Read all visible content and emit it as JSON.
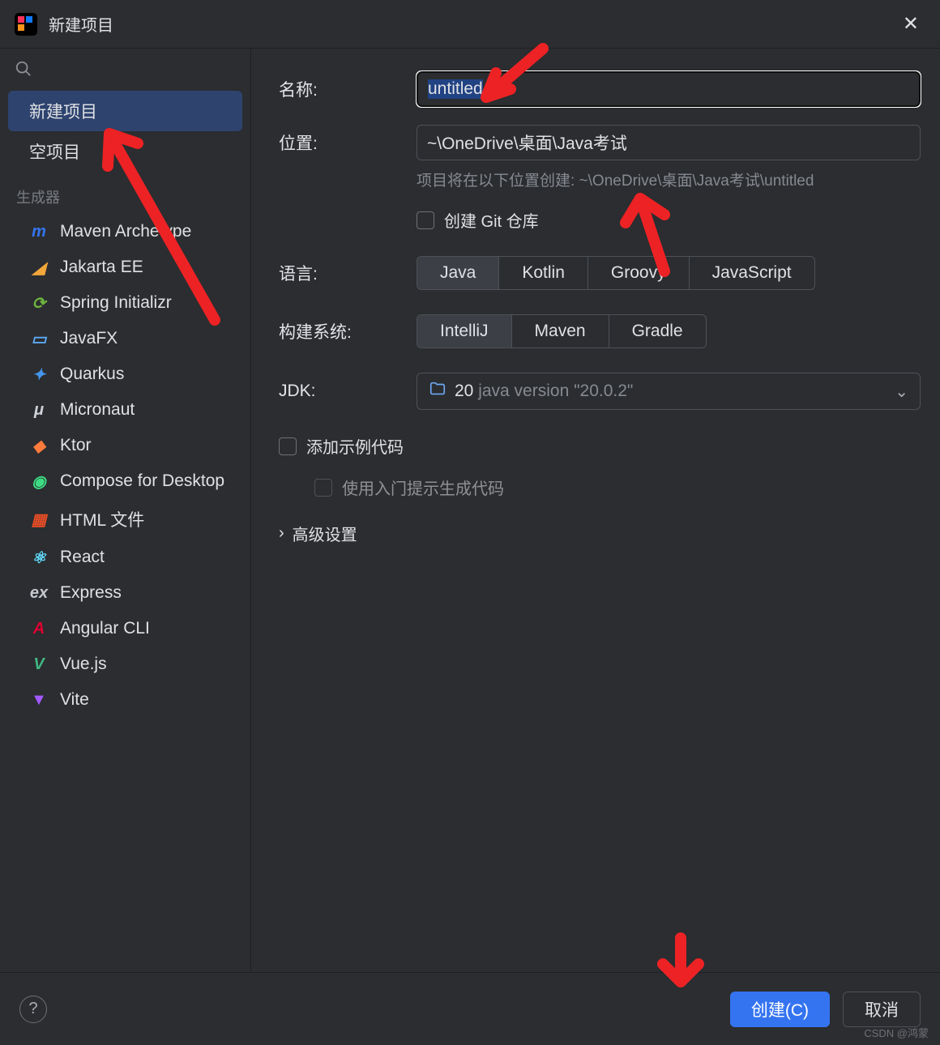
{
  "title": "新建项目",
  "sidebar": {
    "top_items": [
      {
        "label": "新建项目",
        "selected": true
      },
      {
        "label": "空项目",
        "selected": false
      }
    ],
    "section_label": "生成器",
    "generators": [
      {
        "label": "Maven Archetype",
        "color": "#3574f0",
        "glyph": "m"
      },
      {
        "label": "Jakarta EE",
        "color": "#f2a73b",
        "glyph": "◢"
      },
      {
        "label": "Spring Initializr",
        "color": "#6cb33e",
        "glyph": "⟳"
      },
      {
        "label": "JavaFX",
        "color": "#5fa8f5",
        "glyph": "▭"
      },
      {
        "label": "Quarkus",
        "color": "#4695eb",
        "glyph": "✦"
      },
      {
        "label": "Micronaut",
        "color": "#cfd2d8",
        "glyph": "μ"
      },
      {
        "label": "Ktor",
        "color": "#ff7b3c",
        "glyph": "◆"
      },
      {
        "label": "Compose for Desktop",
        "color": "#3ddc84",
        "glyph": "◉"
      },
      {
        "label": "HTML 文件",
        "color": "#e44d26",
        "glyph": "▦"
      },
      {
        "label": "React",
        "color": "#61dafb",
        "glyph": "⚛"
      },
      {
        "label": "Express",
        "color": "#c6c9cf",
        "glyph": "ex"
      },
      {
        "label": "Angular CLI",
        "color": "#dd0031",
        "glyph": "A"
      },
      {
        "label": "Vue.js",
        "color": "#41b883",
        "glyph": "V"
      },
      {
        "label": "Vite",
        "color": "#a259ff",
        "glyph": "▼"
      }
    ]
  },
  "form": {
    "name_label": "名称:",
    "name_value": "untitled",
    "location_label": "位置:",
    "location_value": "~\\OneDrive\\桌面\\Java考试",
    "location_hint": "项目将在以下位置创建: ~\\OneDrive\\桌面\\Java考试\\untitled",
    "git_label": "创建 Git 仓库",
    "language_label": "语言:",
    "languages": [
      "Java",
      "Kotlin",
      "Groovy",
      "JavaScript"
    ],
    "language_selected": "Java",
    "build_label": "构建系统:",
    "builds": [
      "IntelliJ",
      "Maven",
      "Gradle"
    ],
    "build_selected": "IntelliJ",
    "jdk_label": "JDK:",
    "jdk_value_num": "20",
    "jdk_value_text": "java version \"20.0.2\"",
    "sample_label": "添加示例代码",
    "onboarding_label": "使用入门提示生成代码",
    "advanced_label": "高级设置"
  },
  "footer": {
    "create": "创建(C)",
    "cancel": "取消"
  },
  "watermark": "CSDN @鸿蒙"
}
